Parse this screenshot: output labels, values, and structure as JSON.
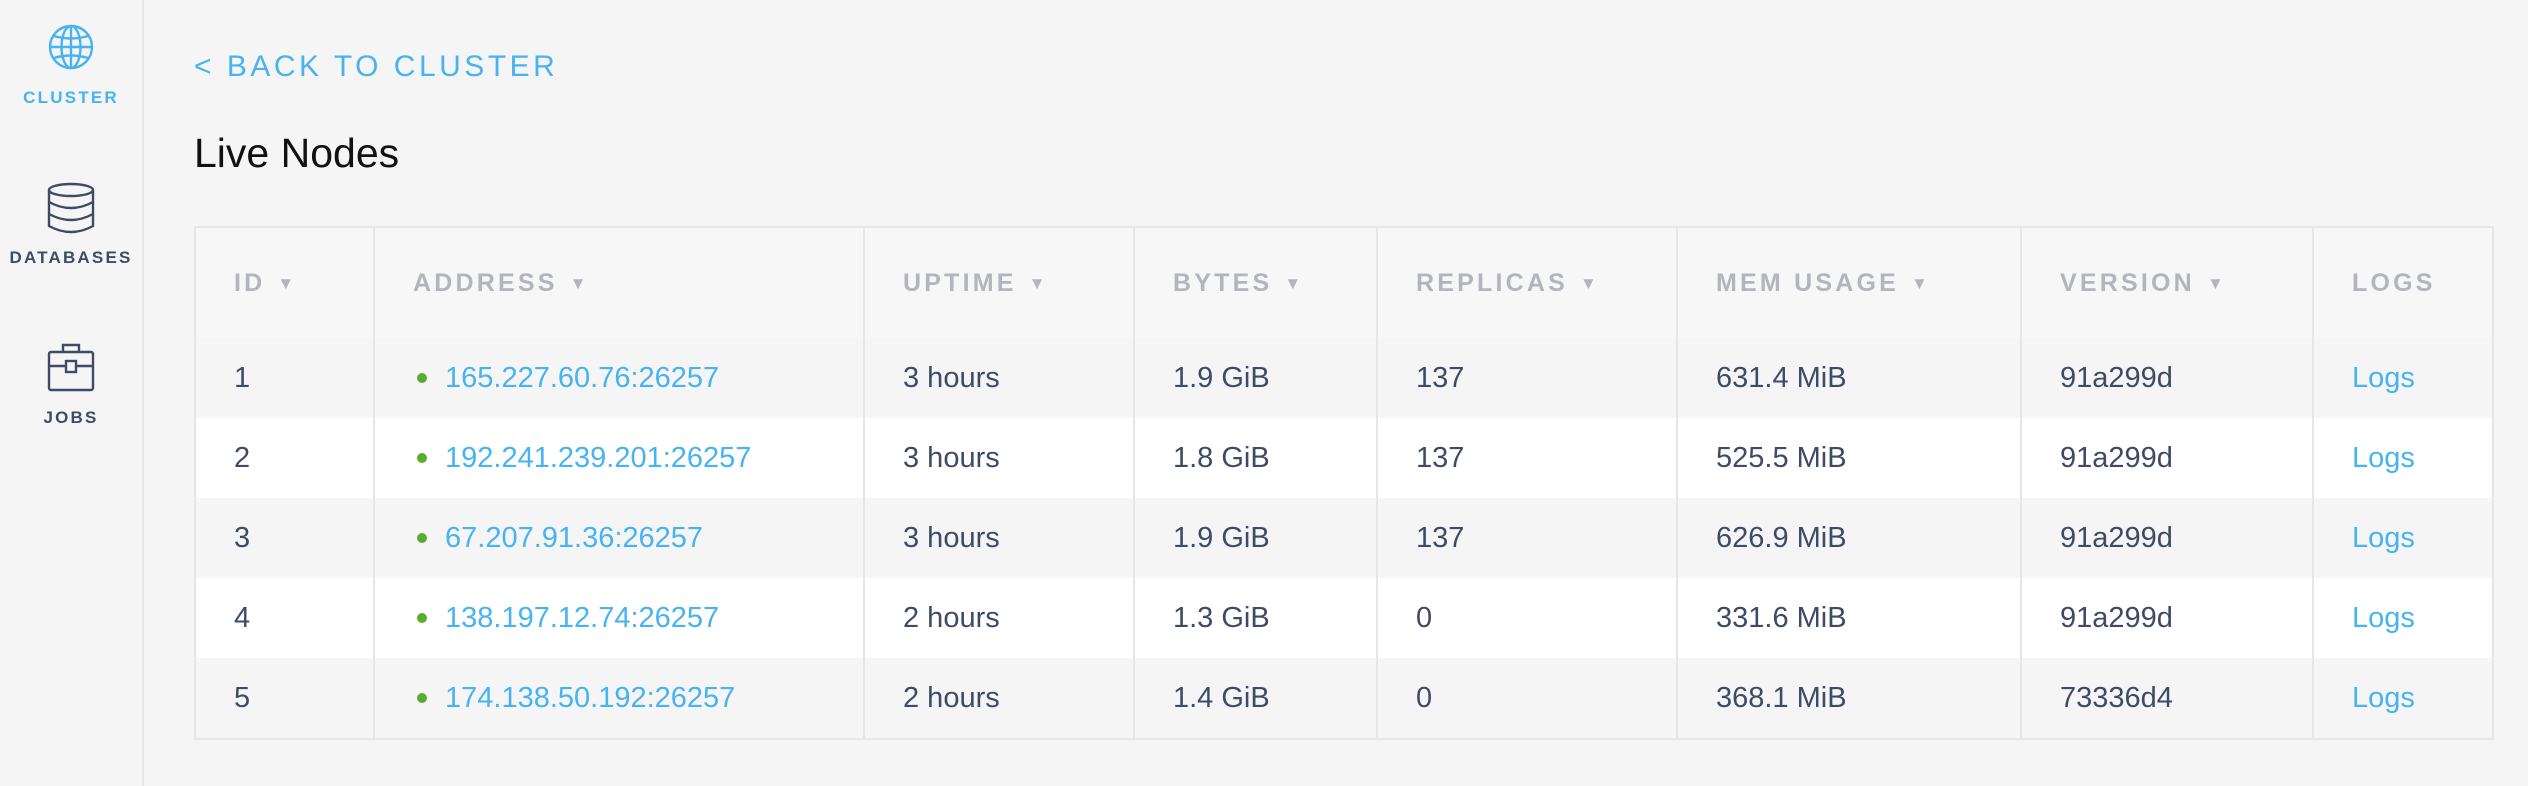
{
  "sidebar": {
    "items": [
      {
        "label": "CLUSTER",
        "icon": "globe-icon",
        "active": true
      },
      {
        "label": "DATABASES",
        "icon": "database-icon",
        "active": false
      },
      {
        "label": "JOBS",
        "icon": "briefcase-icon",
        "active": false
      }
    ]
  },
  "back_link": "< BACK TO CLUSTER",
  "page_title": "Live Nodes",
  "table": {
    "columns": [
      {
        "label": "ID",
        "sortable": true
      },
      {
        "label": "ADDRESS",
        "sortable": true
      },
      {
        "label": "UPTIME",
        "sortable": true
      },
      {
        "label": "BYTES",
        "sortable": true
      },
      {
        "label": "REPLICAS",
        "sortable": true
      },
      {
        "label": "MEM USAGE",
        "sortable": true
      },
      {
        "label": "VERSION",
        "sortable": true
      },
      {
        "label": "LOGS",
        "sortable": false
      }
    ],
    "sort_caret": "▼",
    "rows": [
      {
        "id": "1",
        "address": "165.227.60.76:26257",
        "uptime": "3 hours",
        "bytes": "1.9 GiB",
        "replicas": "137",
        "mem_usage": "631.4 MiB",
        "version": "91a299d",
        "logs": "Logs"
      },
      {
        "id": "2",
        "address": "192.241.239.201:26257",
        "uptime": "3 hours",
        "bytes": "1.8 GiB",
        "replicas": "137",
        "mem_usage": "525.5 MiB",
        "version": "91a299d",
        "logs": "Logs"
      },
      {
        "id": "3",
        "address": "67.207.91.36:26257",
        "uptime": "3 hours",
        "bytes": "1.9 GiB",
        "replicas": "137",
        "mem_usage": "626.9 MiB",
        "version": "91a299d",
        "logs": "Logs"
      },
      {
        "id": "4",
        "address": "138.197.12.74:26257",
        "uptime": "2 hours",
        "bytes": "1.3 GiB",
        "replicas": "0",
        "mem_usage": "331.6 MiB",
        "version": "91a299d",
        "logs": "Logs"
      },
      {
        "id": "5",
        "address": "174.138.50.192:26257",
        "uptime": "2 hours",
        "bytes": "1.4 GiB",
        "replicas": "0",
        "mem_usage": "368.1 MiB",
        "version": "73336d4",
        "logs": "Logs"
      }
    ]
  },
  "colors": {
    "accent": "#47b3f0",
    "text": "#3e4a66",
    "header_text": "#b2b5bc",
    "status_live": "#57ad2c",
    "border": "#e6e6e6"
  }
}
